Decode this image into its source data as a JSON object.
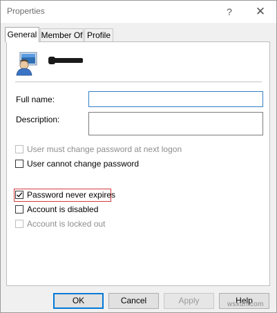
{
  "window": {
    "title": "Properties",
    "help_glyph": "?",
    "close_glyph": "✕"
  },
  "tabs": [
    {
      "label": "General",
      "active": true
    },
    {
      "label": "Member Of",
      "active": false
    },
    {
      "label": "Profile",
      "active": false
    }
  ],
  "user": {
    "name_redacted": true
  },
  "fields": {
    "full_name": {
      "label": "Full name:",
      "value": ""
    },
    "description": {
      "label": "Description:",
      "value": ""
    }
  },
  "options": [
    {
      "label": "User must change password at next logon",
      "checked": false,
      "enabled": false
    },
    {
      "label": "User cannot change password",
      "checked": false,
      "enabled": true
    },
    {
      "label": "Password never expires",
      "checked": true,
      "enabled": true,
      "highlighted": true
    },
    {
      "label": "Account is disabled",
      "checked": false,
      "enabled": true
    },
    {
      "label": "Account is locked out",
      "checked": false,
      "enabled": false
    }
  ],
  "buttons": {
    "ok": "OK",
    "cancel": "Cancel",
    "apply": "Apply",
    "help": "Help"
  },
  "watermark": "wsxdn.com",
  "colors": {
    "focus_border": "#2f7fc5",
    "highlight_box": "#d43a3a",
    "default_button_border": "#0078d7"
  }
}
